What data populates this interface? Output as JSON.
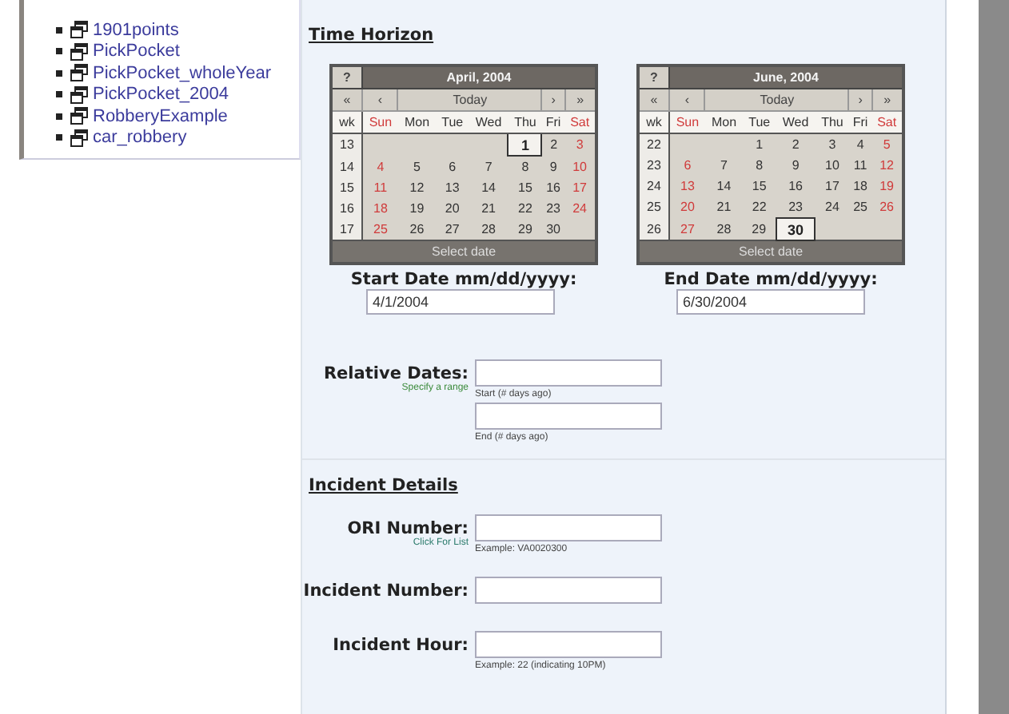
{
  "sidebar": {
    "items": [
      {
        "label": "1901points"
      },
      {
        "label": "PickPocket"
      },
      {
        "label": "PickPocket_wholeYear"
      },
      {
        "label": "PickPocket_2004"
      },
      {
        "label": "RobberyExample"
      },
      {
        "label": "car_robbery"
      }
    ]
  },
  "time_horizon": {
    "title": "Time Horizon",
    "calendars": [
      {
        "help": "?",
        "title": "April, 2004",
        "nav": [
          "«",
          "‹",
          "Today",
          "›",
          "»"
        ],
        "header": [
          "wk",
          "Sun",
          "Mon",
          "Tue",
          "Wed",
          "Thu",
          "Fri",
          "Sat"
        ],
        "footer": "Select date",
        "label": "Start Date mm/dd/yyyy:",
        "value": "4/1/2004",
        "weeks": [
          {
            "wk": "13",
            "days": [
              {
                "kind": "blank"
              },
              {
                "kind": "blank"
              },
              {
                "kind": "blank"
              },
              {
                "kind": "blank"
              },
              {
                "kind": "day",
                "day": "1",
                "selected": true
              },
              {
                "kind": "day",
                "day": "2",
                "selected": false
              },
              {
                "kind": "day",
                "day": "3",
                "selected": false
              }
            ]
          },
          {
            "wk": "14",
            "days": [
              {
                "kind": "day",
                "day": "4",
                "selected": false
              },
              {
                "kind": "day",
                "day": "5",
                "selected": false
              },
              {
                "kind": "day",
                "day": "6",
                "selected": false
              },
              {
                "kind": "day",
                "day": "7",
                "selected": false
              },
              {
                "kind": "day",
                "day": "8",
                "selected": false
              },
              {
                "kind": "day",
                "day": "9",
                "selected": false
              },
              {
                "kind": "day",
                "day": "10",
                "selected": false
              }
            ]
          },
          {
            "wk": "15",
            "days": [
              {
                "kind": "day",
                "day": "11",
                "selected": false
              },
              {
                "kind": "day",
                "day": "12",
                "selected": false
              },
              {
                "kind": "day",
                "day": "13",
                "selected": false
              },
              {
                "kind": "day",
                "day": "14",
                "selected": false
              },
              {
                "kind": "day",
                "day": "15",
                "selected": false
              },
              {
                "kind": "day",
                "day": "16",
                "selected": false
              },
              {
                "kind": "day",
                "day": "17",
                "selected": false
              }
            ]
          },
          {
            "wk": "16",
            "days": [
              {
                "kind": "day",
                "day": "18",
                "selected": false
              },
              {
                "kind": "day",
                "day": "19",
                "selected": false
              },
              {
                "kind": "day",
                "day": "20",
                "selected": false
              },
              {
                "kind": "day",
                "day": "21",
                "selected": false
              },
              {
                "kind": "day",
                "day": "22",
                "selected": false
              },
              {
                "kind": "day",
                "day": "23",
                "selected": false
              },
              {
                "kind": "day",
                "day": "24",
                "selected": false
              }
            ]
          },
          {
            "wk": "17",
            "days": [
              {
                "kind": "day",
                "day": "25",
                "selected": false
              },
              {
                "kind": "day",
                "day": "26",
                "selected": false
              },
              {
                "kind": "day",
                "day": "27",
                "selected": false
              },
              {
                "kind": "day",
                "day": "28",
                "selected": false
              },
              {
                "kind": "day",
                "day": "29",
                "selected": false
              },
              {
                "kind": "day",
                "day": "30",
                "selected": false
              },
              {
                "kind": "blank"
              }
            ]
          }
        ]
      },
      {
        "help": "?",
        "title": "June, 2004",
        "nav": [
          "«",
          "‹",
          "Today",
          "›",
          "»"
        ],
        "header": [
          "wk",
          "Sun",
          "Mon",
          "Tue",
          "Wed",
          "Thu",
          "Fri",
          "Sat"
        ],
        "footer": "Select date",
        "label": "End Date mm/dd/yyyy:",
        "value": "6/30/2004",
        "weeks": [
          {
            "wk": "22",
            "days": [
              {
                "kind": "blank"
              },
              {
                "kind": "blank"
              },
              {
                "kind": "day",
                "day": "1",
                "selected": false
              },
              {
                "kind": "day",
                "day": "2",
                "selected": false
              },
              {
                "kind": "day",
                "day": "3",
                "selected": false
              },
              {
                "kind": "day",
                "day": "4",
                "selected": false
              },
              {
                "kind": "day",
                "day": "5",
                "selected": false
              }
            ]
          },
          {
            "wk": "23",
            "days": [
              {
                "kind": "day",
                "day": "6",
                "selected": false
              },
              {
                "kind": "day",
                "day": "7",
                "selected": false
              },
              {
                "kind": "day",
                "day": "8",
                "selected": false
              },
              {
                "kind": "day",
                "day": "9",
                "selected": false
              },
              {
                "kind": "day",
                "day": "10",
                "selected": false
              },
              {
                "kind": "day",
                "day": "11",
                "selected": false
              },
              {
                "kind": "day",
                "day": "12",
                "selected": false
              }
            ]
          },
          {
            "wk": "24",
            "days": [
              {
                "kind": "day",
                "day": "13",
                "selected": false
              },
              {
                "kind": "day",
                "day": "14",
                "selected": false
              },
              {
                "kind": "day",
                "day": "15",
                "selected": false
              },
              {
                "kind": "day",
                "day": "16",
                "selected": false
              },
              {
                "kind": "day",
                "day": "17",
                "selected": false
              },
              {
                "kind": "day",
                "day": "18",
                "selected": false
              },
              {
                "kind": "day",
                "day": "19",
                "selected": false
              }
            ]
          },
          {
            "wk": "25",
            "days": [
              {
                "kind": "day",
                "day": "20",
                "selected": false
              },
              {
                "kind": "day",
                "day": "21",
                "selected": false
              },
              {
                "kind": "day",
                "day": "22",
                "selected": false
              },
              {
                "kind": "day",
                "day": "23",
                "selected": false
              },
              {
                "kind": "day",
                "day": "24",
                "selected": false
              },
              {
                "kind": "day",
                "day": "25",
                "selected": false
              },
              {
                "kind": "day",
                "day": "26",
                "selected": false
              }
            ]
          },
          {
            "wk": "26",
            "days": [
              {
                "kind": "day",
                "day": "27",
                "selected": false
              },
              {
                "kind": "day",
                "day": "28",
                "selected": false
              },
              {
                "kind": "day",
                "day": "29",
                "selected": false
              },
              {
                "kind": "day",
                "day": "30",
                "selected": true
              },
              {
                "kind": "blank"
              },
              {
                "kind": "blank"
              },
              {
                "kind": "blank"
              }
            ]
          }
        ]
      }
    ],
    "relative": {
      "label": "Relative Dates:",
      "hint": "Specify a range",
      "start_caption": "Start (# days ago)",
      "end_caption": "End (# days ago)"
    }
  },
  "incident_details": {
    "title": "Incident Details",
    "fields": [
      {
        "label": "ORI Number:",
        "link": "Click For List",
        "caption": "Example: VA0020300"
      },
      {
        "label": "Incident Number:"
      },
      {
        "label": "Incident Hour:",
        "caption": "Example: 22 (indicating 10PM)"
      }
    ]
  }
}
